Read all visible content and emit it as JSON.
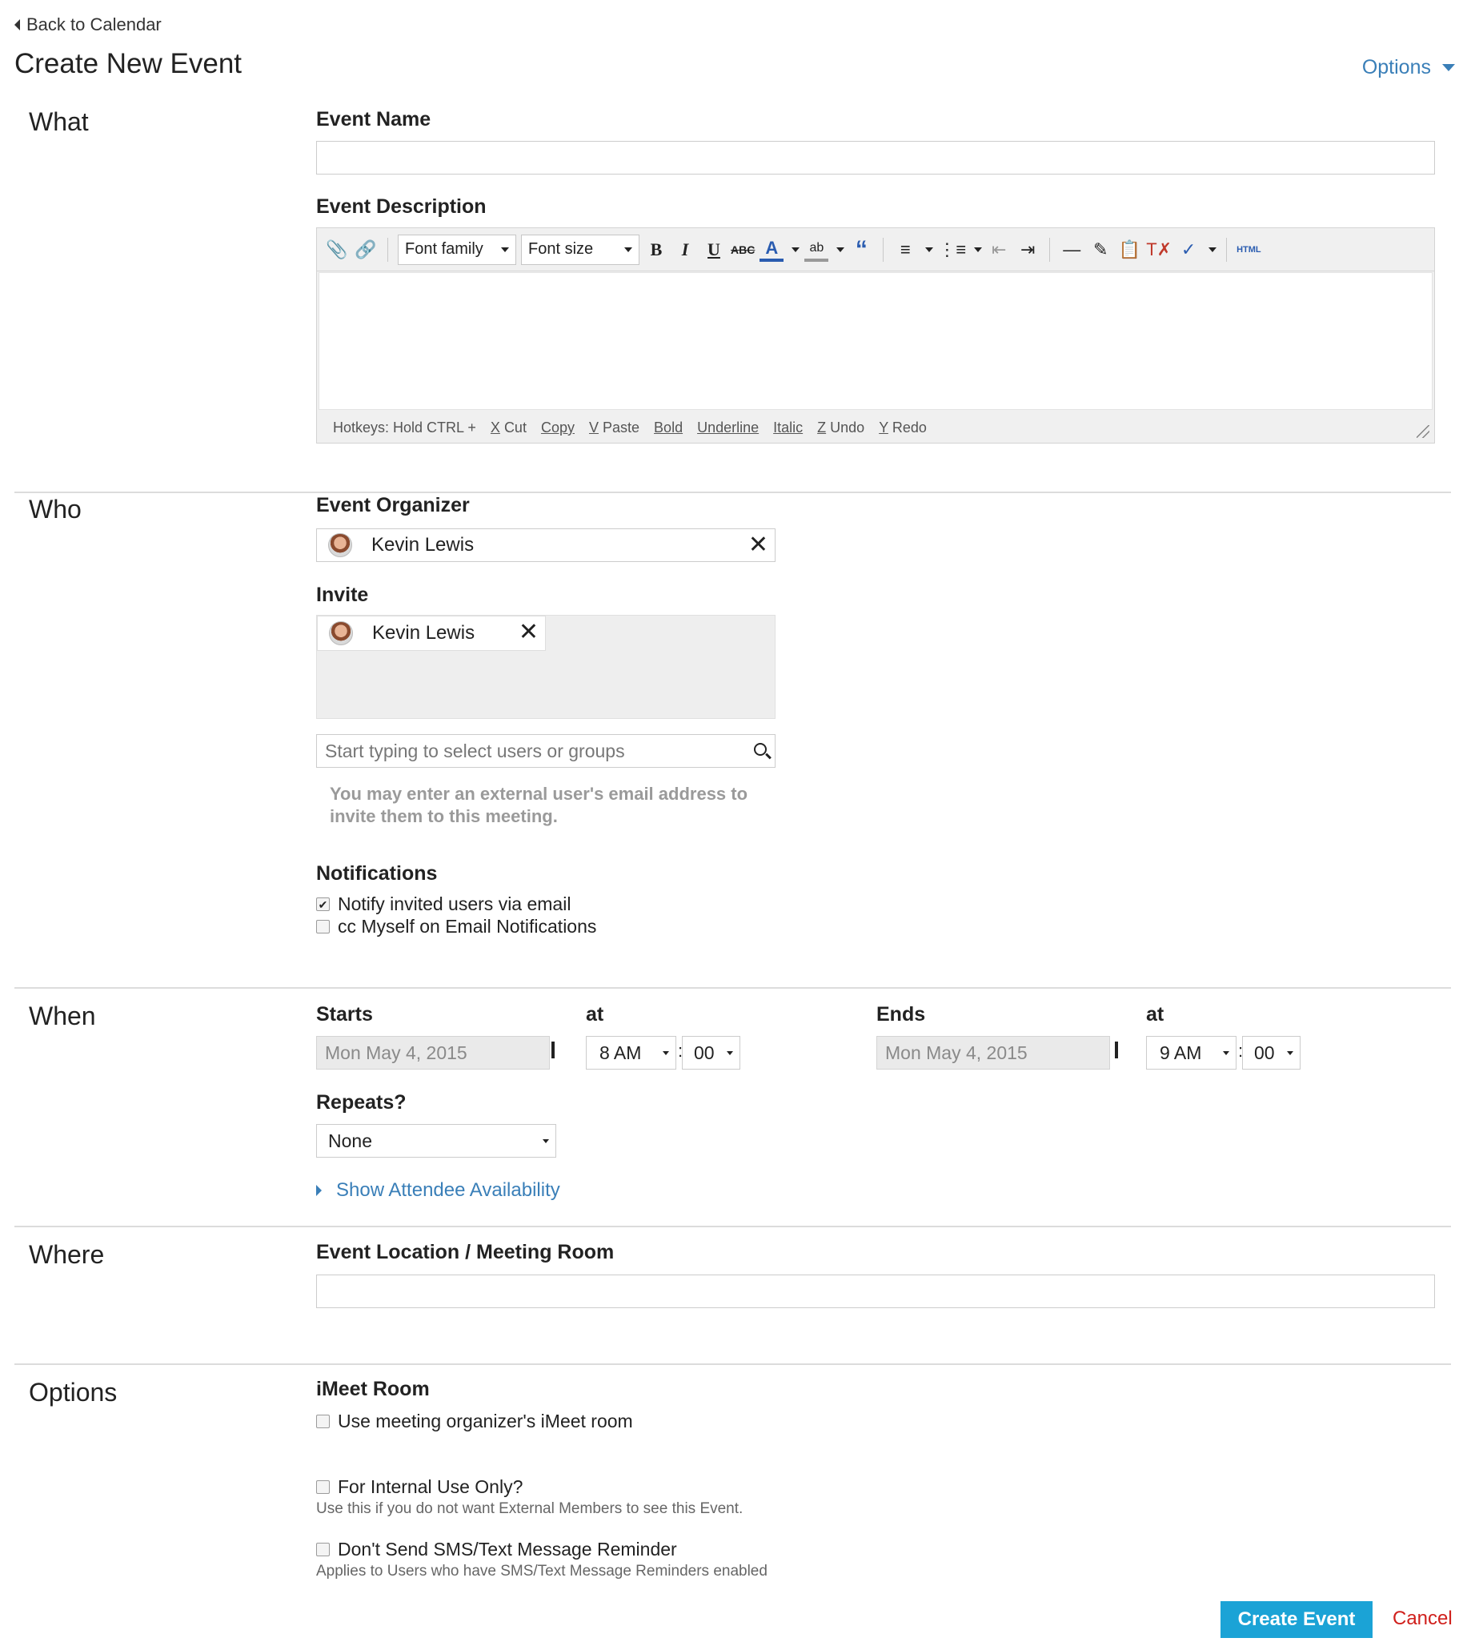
{
  "nav": {
    "back_label": "Back to Calendar"
  },
  "page": {
    "title": "Create New Event",
    "options_label": "Options"
  },
  "sections": {
    "what": "What",
    "who": "Who",
    "when": "When",
    "where": "Where",
    "options": "Options"
  },
  "what": {
    "event_name_label": "Event Name",
    "event_name_value": "",
    "event_description_label": "Event Description",
    "toolbar": {
      "font_family": "Font family",
      "font_size": "Font size",
      "bold": "B",
      "italic": "I",
      "underline": "U",
      "strikethrough": "ABC",
      "font_color": "A",
      "highlight": "ab",
      "quote": "“",
      "html": "HTML"
    },
    "hotkeys": {
      "prefix": "Hotkeys: Hold CTRL +",
      "items": [
        {
          "key": "X",
          "label": "Cut"
        },
        {
          "key": "C",
          "label": "Copy"
        },
        {
          "key": "V",
          "label": "Paste"
        },
        {
          "key": "B",
          "label": "Bold"
        },
        {
          "key": "U",
          "label": "Underline"
        },
        {
          "key": "I",
          "label": "Italic"
        },
        {
          "key": "Z",
          "label": "Undo"
        },
        {
          "key": "Y",
          "label": "Redo"
        }
      ]
    }
  },
  "who": {
    "organizer_label": "Event Organizer",
    "organizer_name": "Kevin Lewis",
    "invite_label": "Invite",
    "invitees": [
      {
        "name": "Kevin Lewis"
      }
    ],
    "search_placeholder": "Start typing to select users or groups",
    "external_hint": "You may enter an external user's email address to invite them to this meeting.",
    "notifications_label": "Notifications",
    "notify_option": "Notify invited users via email",
    "notify_checked": true,
    "cc_option": "cc Myself on Email Notifications",
    "cc_checked": false
  },
  "when": {
    "starts_label": "Starts",
    "at_label": "at",
    "start_date": "Mon May 4, 2015",
    "start_hour": "8 AM",
    "start_minute": "00",
    "ends_label": "Ends",
    "end_date": "Mon May 4, 2015",
    "end_hour": "9 AM",
    "end_minute": "00",
    "repeats_label": "Repeats?",
    "repeats_value": "None",
    "availability_link": "Show Attendee Availability"
  },
  "where": {
    "location_label": "Event Location / Meeting Room",
    "location_value": ""
  },
  "options": {
    "imeet_label": "iMeet Room",
    "imeet_option": "Use meeting organizer's iMeet room",
    "internal_option": "For Internal Use Only?",
    "internal_note": "Use this if you do not want External Members to see this Event.",
    "sms_option": "Don't Send SMS/Text Message Reminder",
    "sms_note": "Applies to Users who have SMS/Text Message Reminders enabled"
  },
  "actions": {
    "create_label": "Create Event",
    "cancel_label": "Cancel"
  },
  "colors": {
    "accent": "#3a7fb8",
    "primary_button": "#1ba3d6",
    "cancel": "#d0201c"
  }
}
